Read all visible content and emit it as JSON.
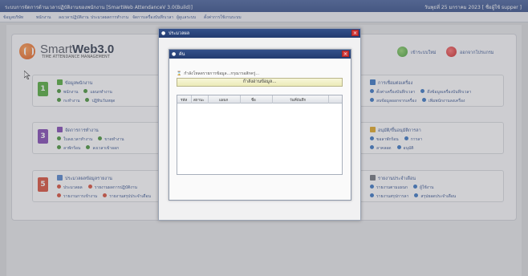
{
  "window": {
    "title": "ระบบการจัดการด้านเวลาปฏิบัติงานของพนักงาน [SmartWeb AttendanceV 3.0(Build)]",
    "status": "วันพุธที่ 25 มกราคม 2023 [ ชื่อผู้ใช้ supper ]"
  },
  "menu": [
    "ข้อมูลบริษัท",
    "พนักงาน",
    "ลงเวลาปฏิบัติงาน",
    "ประมวลผลการทำงาน",
    "จัดการเครื่องบันทึกเวลา",
    "ผู้ดูแลระบบ",
    "ตั้งค่าการใช้งานระบบ"
  ],
  "brand": {
    "word_light": "Smart",
    "word_bold": "Web3.0",
    "subtitle": "TIME ATTENDANCE MANAGEMENT"
  },
  "header_actions": {
    "refresh": "เข้าระบบใหม่",
    "logout": "ออกจากโปรแกรม"
  },
  "groups": [
    {
      "num": "1",
      "color": "#4aa832",
      "title": "ข้อมูลพนักงาน",
      "links": [
        "พนักงาน",
        "แผนกทำงาน",
        "กะทำงาน",
        "ปฏิทินวันหยุด"
      ]
    },
    {
      "num": "3",
      "color": "#7b3fb0",
      "title": "จัดการการทำงาน",
      "links": [
        "ใบลงเวลาทำงาน",
        "ขาดทำงาน",
        "ลาพักร้อน",
        "ลงเวลาเข้าออก"
      ]
    },
    {
      "num": "5",
      "color": "#d7452f",
      "title": "ประมวลผลข้อมูลรายงาน",
      "links": [
        "ประมวลผล",
        "รายงานผลการปฏิบัติงาน",
        "รายงานการเข้างาน",
        "รายงานสรุปประจำเดือน"
      ]
    },
    {
      "num": "2",
      "color": "#2f6fc0",
      "title": "การเชื่อมต่อเครื่อง",
      "links": [
        "ตั้งค่าเครื่องบันทึกเวลา",
        "ดึงข้อมูลเครื่องบันทึกเวลา",
        "ลบข้อมูลออกจากเครื่อง",
        "เพิ่มพนักงานลงเครื่อง"
      ]
    },
    {
      "num": "4",
      "color": "#e0a318",
      "title": "อนุมัติ/ขึ้นอนุมัติการลา",
      "links": [
        "ขอลาพักร้อน",
        "การลา",
        "ลาคลอด",
        "อนุมัติ"
      ]
    },
    {
      "num": "6",
      "color": "#8b8f96",
      "title": "รายงานประจำเดือน",
      "links": [
        "รายงานตามแผนก",
        "ผู้ใช้งาน",
        "รายงานสรุปการลา",
        "สรุปยอดประจำเดือน"
      ]
    }
  ],
  "outer_dialog": {
    "title": "ประมวลผล"
  },
  "inner_dialog": {
    "title": "ค้น",
    "loading_text": "กำลังโหลดรายการข้อมูล...กรุณารอสักครู่...",
    "progress_text": "กำลังอ่านข้อมูล..."
  },
  "table": {
    "columns": [
      "รหัส",
      "สถานะ",
      "แผนก",
      "ชื่อ",
      "วันที่บันทึก"
    ]
  }
}
